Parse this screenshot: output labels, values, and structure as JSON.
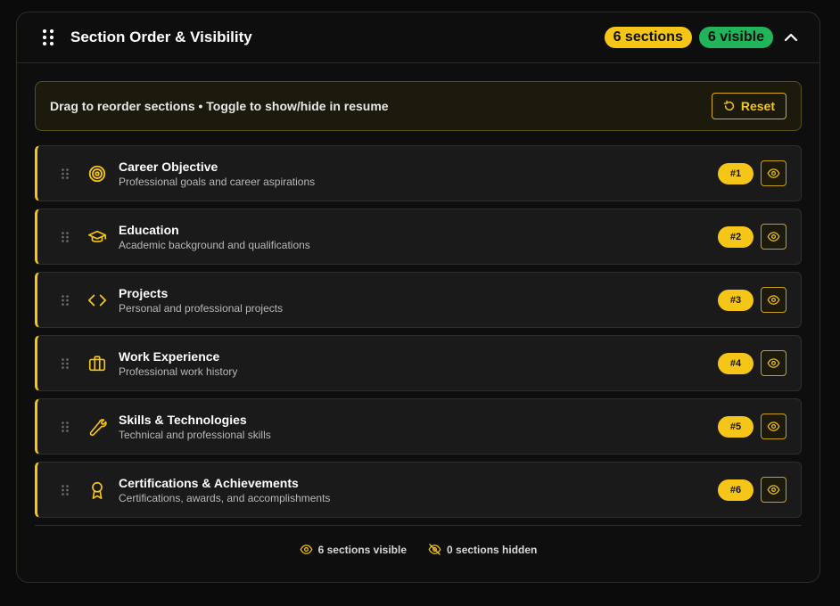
{
  "header": {
    "title": "Section Order & Visibility",
    "sections_badge": "6 sections",
    "visible_badge": "6 visible",
    "icons": {
      "grip": "grip-icon",
      "collapse": "chevron-up-icon"
    }
  },
  "info": {
    "text": "Drag to reorder sections • Toggle to show/hide in resume",
    "reset_label": "Reset",
    "reset_icon": "rotate-ccw-icon"
  },
  "sections": [
    {
      "title": "Career Objective",
      "description": "Professional goals and career aspirations",
      "order": "#1",
      "icon": "target-icon",
      "visible": true
    },
    {
      "title": "Education",
      "description": "Academic background and qualifications",
      "order": "#2",
      "icon": "graduation-cap-icon",
      "visible": true
    },
    {
      "title": "Projects",
      "description": "Personal and professional projects",
      "order": "#3",
      "icon": "code-icon",
      "visible": true
    },
    {
      "title": "Work Experience",
      "description": "Professional work history",
      "order": "#4",
      "icon": "briefcase-icon",
      "visible": true
    },
    {
      "title": "Skills & Technologies",
      "description": "Technical and professional skills",
      "order": "#5",
      "icon": "wrench-icon",
      "visible": true
    },
    {
      "title": "Certifications & Achievements",
      "description": "Certifications, awards, and accomplishments",
      "order": "#6",
      "icon": "award-icon",
      "visible": true
    }
  ],
  "footer": {
    "visible_text": "6 sections visible",
    "hidden_text": "0 sections hidden"
  },
  "colors": {
    "accent": "#f5c518",
    "success": "#22b45a",
    "background": "#0e0e0e",
    "row": "#1a1a1a"
  }
}
